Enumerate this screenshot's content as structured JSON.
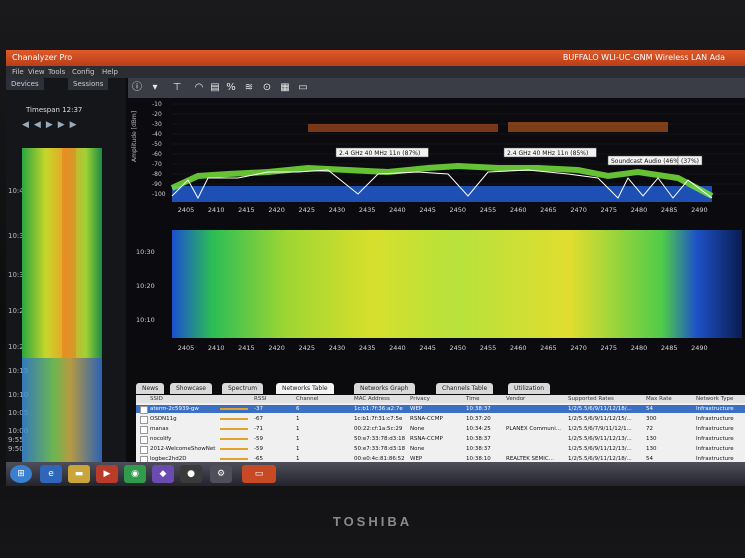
{
  "device": {
    "brand": "TOSHIBA"
  },
  "window": {
    "title": "Chanalyzer Pro",
    "adapter": "BUFFALO WLI-UC-GNM Wireless LAN Ada",
    "colors": {
      "titlebar": "#d44a22",
      "toolbar": "#3a3d45"
    }
  },
  "menu": [
    "File",
    "View",
    "Tools",
    "Config",
    "Help"
  ],
  "left": {
    "tabs": [
      "Devices",
      "Sessions"
    ],
    "timespan": "Timespan 12:37",
    "times": [
      {
        "label": "10:40",
        "y": 0.13
      },
      {
        "label": "10:35",
        "y": 0.28
      },
      {
        "label": "10:30",
        "y": 0.41
      },
      {
        "label": "10:25",
        "y": 0.53
      },
      {
        "label": "10:20",
        "y": 0.65
      },
      {
        "label": "10:15",
        "y": 0.73
      },
      {
        "label": "10:10",
        "y": 0.81
      },
      {
        "label": "10:05",
        "y": 0.87
      },
      {
        "label": "10:00",
        "y": 0.93
      },
      {
        "label": "9:55",
        "y": 0.96
      },
      {
        "label": "9:50",
        "y": 0.99
      }
    ]
  },
  "toolbar": {
    "icons": [
      "info-icon",
      "marker-icon",
      "pin-icon",
      "spectrum-icon",
      "waterfall-icon",
      "percent-icon",
      "wifi-icon",
      "signal-icon",
      "grid-icon",
      "note-icon"
    ]
  },
  "spectrum": {
    "ylabel": "Amplitude [dBm]",
    "yticks": [
      "-10",
      "-20",
      "-30",
      "-40",
      "-50",
      "-60",
      "-70",
      "-80",
      "-90",
      "-100"
    ],
    "xticks": [
      "2405",
      "2410",
      "2415",
      "2420",
      "2425",
      "2430",
      "2435",
      "2440",
      "2445",
      "2450",
      "2455",
      "2460",
      "2465",
      "2470",
      "2475",
      "2480",
      "2485",
      "2490"
    ],
    "annotations": [
      {
        "label": "2.4 GHz 40 MHz 11n (87%)"
      },
      {
        "label": "2.4 GHz 40 MHz 11n (85%)"
      },
      {
        "label": "Soundcast Audio (46%)"
      },
      {
        "label": "(37%)"
      }
    ]
  },
  "waterfall": {
    "yticks": [
      "10:30",
      "10:20",
      "10:10"
    ]
  },
  "tabs": [
    "News",
    "Showcase",
    "Spectrum",
    "Networks Table",
    "Networks Graph",
    "Channels Table",
    "Utilization"
  ],
  "table": {
    "headers": [
      "SSID",
      "RSSI",
      "Channel",
      "MAC Address",
      "Privacy",
      "Time",
      "Vendor",
      "Supported Rates",
      "Max Rate",
      "Network Type"
    ],
    "rows": [
      [
        "aterm-2c5939-gw",
        "-37",
        "6",
        "1c:b1:7f:36:a2:7e",
        "WEP",
        "10:38:37",
        "",
        "1/2/5.5/6/9/11/12/18/...",
        "54",
        "Infrastructure"
      ],
      [
        "OSDN11g",
        "-67",
        "1",
        "1c:b1:7f:31:c7:5e",
        "RSNA-CCMP",
        "10:37:20",
        "",
        "1/2/5.5/6/9/11/12/15/...",
        "300",
        "Infrastructure"
      ],
      [
        "manas",
        "-71",
        "1",
        "00:22:cf:1a:5c:29",
        "None",
        "10:34:25",
        "PLANEX Communi...",
        "1/2/5.5/6/7/9/11/12/1...",
        "72",
        "Infrastructure"
      ],
      [
        "nocolify",
        "-59",
        "1",
        "50:e7:33:78:d3:18",
        "RSNA-CCMP",
        "10:38:37",
        "",
        "1/2/5.5/6/9/11/12/13/...",
        "130",
        "Infrastructure"
      ],
      [
        "2012-WelcomeShowNet",
        "-59",
        "1",
        "50:e7:33:78:d3:18",
        "None",
        "10:38:37",
        "",
        "1/2/5.5/6/9/11/12/13/...",
        "130",
        "Infrastructure"
      ],
      [
        "logbec2hd2D",
        "-65",
        "1",
        "00:e0:4c:81:86:52",
        "WEP",
        "10:38:10",
        "REALTEK SEMIC...",
        "1/2/5.5/6/9/11/12/18/...",
        "54",
        "Infrastructure"
      ],
      [
        "2012-WelcomeShowNet",
        "-65",
        "1",
        "50:e7:33:78:be:08",
        "None",
        "10:38:37",
        "",
        "1/2/5.5/6/9/11/12/13/...",
        "130",
        "Infrastructure"
      ],
      [
        "moNIC1",
        "-63",
        "1",
        "50:e7:33:78:be:09",
        "WPA-TKIP",
        "10:38:27",
        "",
        "1/2/5.5/6/9/11/12/13/...",
        "130",
        "Infrastructure"
      ]
    ]
  }
}
